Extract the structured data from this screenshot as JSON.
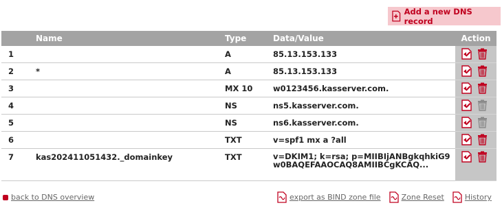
{
  "add_button": {
    "label": "Add a new DNS record"
  },
  "table": {
    "headers": {
      "num": "",
      "name": "Name",
      "type": "Type",
      "data": "Data/Value",
      "action": "Action"
    },
    "rows": [
      {
        "num": "1",
        "name": "",
        "type": "A",
        "data": "85.13.153.133",
        "delete_enabled": true
      },
      {
        "num": "2",
        "name": "*",
        "type": "A",
        "data": "85.13.153.133",
        "delete_enabled": true
      },
      {
        "num": "3",
        "name": "",
        "type": "MX 10",
        "data": "w0123456.kasserver.com.",
        "delete_enabled": true
      },
      {
        "num": "4",
        "name": "",
        "type": "NS",
        "data": "ns5.kasserver.com.",
        "delete_enabled": false
      },
      {
        "num": "5",
        "name": "",
        "type": "NS",
        "data": "ns6.kasserver.com.",
        "delete_enabled": false
      },
      {
        "num": "6",
        "name": "",
        "type": "TXT",
        "data": "v=spf1 mx a ?all",
        "delete_enabled": true
      },
      {
        "num": "7",
        "name": "kas202411051432._domainkey",
        "type": "TXT",
        "data": "v=DKIM1; k=rsa; p=MIIBIjANBgkqhkiG9w0BAQEFAAOCAQ8AMIIBCgKCAQ...",
        "delete_enabled": true
      }
    ]
  },
  "footer": {
    "back_label": "back to DNS overview",
    "export_label": "export as BIND zone file",
    "reset_label": "Zone Reset",
    "history_label": "History"
  },
  "colors": {
    "accent": "#c0001f",
    "header_bg": "#a3a3a3",
    "action_bg": "#c6c6c6",
    "disabled": "#8a8a8a"
  }
}
